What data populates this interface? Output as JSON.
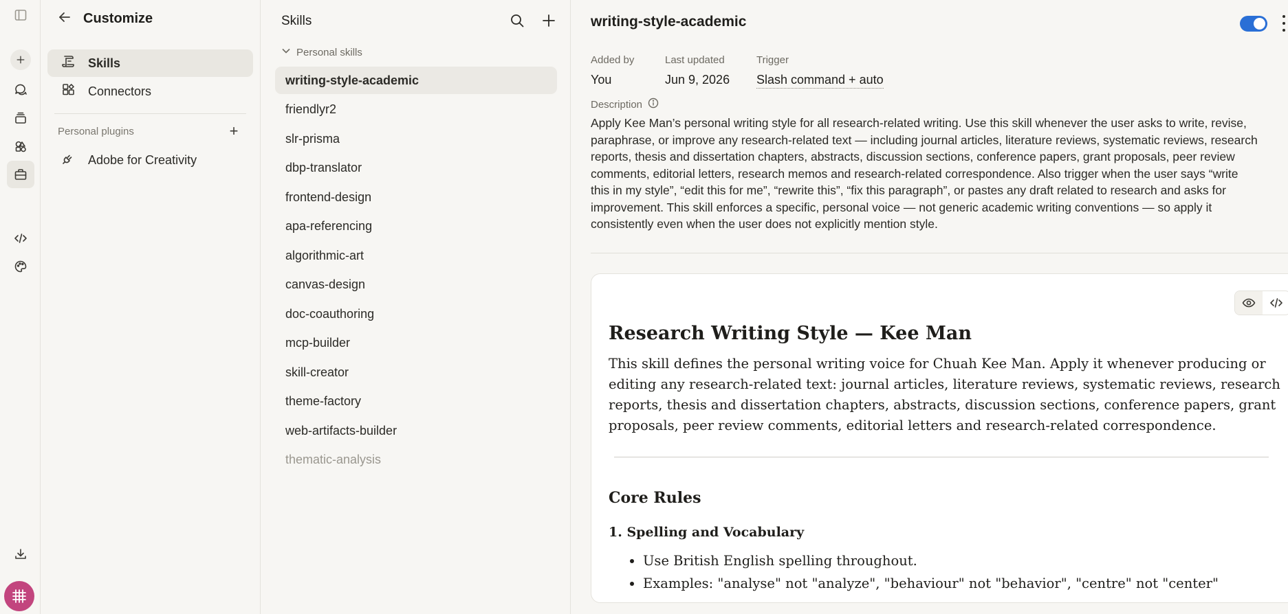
{
  "rail": {
    "icons": [
      "sidebar-toggle-icon",
      "new-chat-icon",
      "chats-icon",
      "projects-icon",
      "artifacts-icon",
      "customize-icon",
      "code-icon",
      "palette-icon",
      "download-icon"
    ]
  },
  "customize": {
    "title": "Customize",
    "nav": [
      {
        "label": "Skills",
        "active": true
      },
      {
        "label": "Connectors",
        "active": false
      }
    ],
    "plugins_section": "Personal plugins",
    "plugins": [
      {
        "label": "Adobe for Creativity"
      }
    ]
  },
  "skills": {
    "title": "Skills",
    "group": "Personal skills",
    "items": [
      "writing-style-academic",
      "friendlyr2",
      "slr-prisma",
      "dbp-translator",
      "frontend-design",
      "apa-referencing",
      "algorithmic-art",
      "canvas-design",
      "doc-coauthoring",
      "mcp-builder",
      "skill-creator",
      "theme-factory",
      "web-artifacts-builder",
      "thematic-analysis"
    ],
    "active_index": 0,
    "muted_index": 13
  },
  "detail": {
    "title": "writing-style-academic",
    "enabled": true,
    "added_by_label": "Added by",
    "added_by": "You",
    "updated_label": "Last updated",
    "updated": "Jun 9, 2026",
    "trigger_label": "Trigger",
    "trigger": "Slash command + auto",
    "description_label": "Description",
    "description_lines": [
      "Apply Kee Man’s personal writing style for all research-related writing. Use this skill whenever the user asks to write, revise,",
      "paraphrase, or improve any research-related text — including journal articles, literature reviews, systematic reviews, research",
      "reports, thesis and dissertation chapters, abstracts, discussion sections, conference papers, grant proposals, peer review",
      "comments, editorial letters, research memos and research-related correspondence. Also trigger when the user says “write",
      "this in my style”, “edit this for me”, “rewrite this”, “fix this paragraph”, or pastes any draft related to research and asks for",
      "improvement. This skill enforces a specific, personal voice — not generic academic writing conventions — so apply it",
      "consistently even when the user does not explicitly mention style."
    ]
  },
  "doc": {
    "h1": "Research Writing Style — Kee Man",
    "intro": "This skill defines the personal writing voice for Chuah Kee Man. Apply it whenever producing or editing any research-related text: journal articles, literature reviews, systematic reviews, research reports, thesis and dissertation chapters, abstracts, discussion sections, conference papers, grant proposals, peer review comments, editorial letters and research-related correspondence.",
    "h2": "Core Rules",
    "h3": "1. Spelling and Vocabulary",
    "bullets": [
      "Use British English spelling throughout.",
      "Examples: \"analyse\" not \"analyze\", \"behaviour\" not \"behavior\", \"centre\" not \"center\""
    ]
  },
  "colors": {
    "accent": "#2a6fd6",
    "avatar": "#c2457e",
    "background": "#f7f6f3",
    "active_bg": "#e9e7e1"
  }
}
